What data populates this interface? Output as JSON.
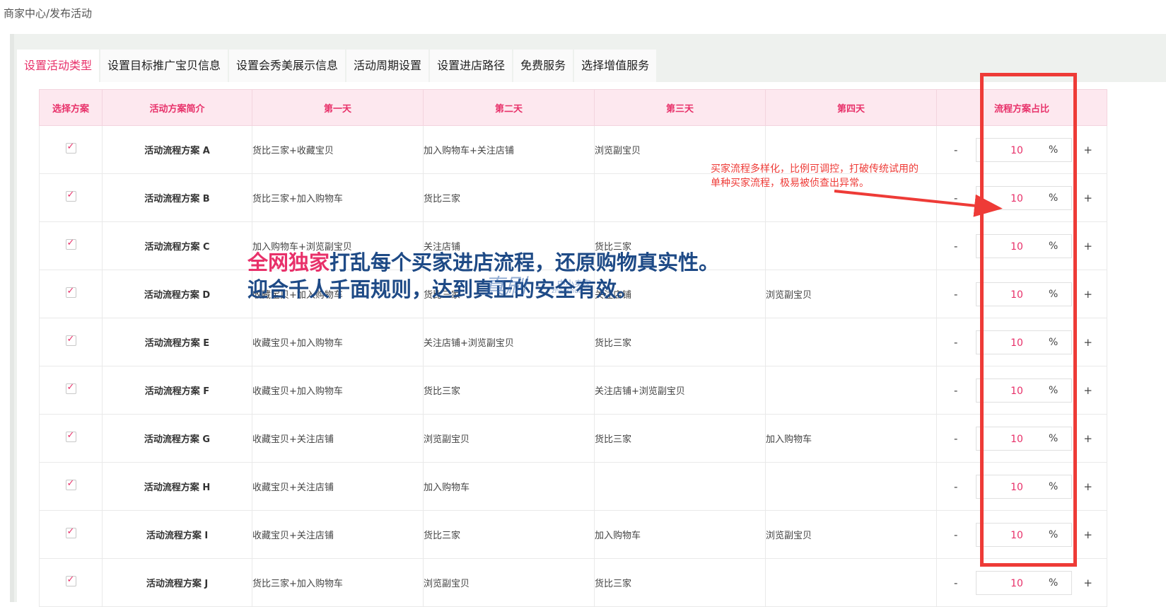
{
  "breadcrumb": "商家中心/发布活动",
  "tabs": [
    {
      "label": "设置活动类型",
      "active": true
    },
    {
      "label": "设置目标推广宝贝信息",
      "active": false
    },
    {
      "label": "设置会秀美展示信息",
      "active": false
    },
    {
      "label": "活动周期设置",
      "active": false
    },
    {
      "label": "设置进店路径",
      "active": false
    },
    {
      "label": "免费服务",
      "active": false
    },
    {
      "label": "选择增值服务",
      "active": false
    }
  ],
  "table": {
    "headers": [
      "选择方案",
      "活动方案简介",
      "第一天",
      "第二天",
      "第三天",
      "第四天",
      "流程方案占比"
    ],
    "rows": [
      {
        "checked": true,
        "name": "活动流程方案 A",
        "day1": "货比三家+收藏宝贝",
        "day2": "加入购物车+关注店铺",
        "day3": "浏览副宝贝",
        "day4": "",
        "ratio": "10",
        "unit": "%"
      },
      {
        "checked": true,
        "name": "活动流程方案 B",
        "day1": "货比三家+加入购物车",
        "day2": "货比三家",
        "day3": "",
        "day4": "",
        "ratio": "10",
        "unit": "%"
      },
      {
        "checked": true,
        "name": "活动流程方案 C",
        "day1": "加入购物车+浏览副宝贝",
        "day2": "关注店铺",
        "day3": "货比三家",
        "day4": "",
        "ratio": "10",
        "unit": "%"
      },
      {
        "checked": true,
        "name": "活动流程方案 D",
        "day1": "收藏宝贝+加入购物车",
        "day2": "货比三家",
        "day3": "关注店铺",
        "day4": "浏览副宝贝",
        "ratio": "10",
        "unit": "%"
      },
      {
        "checked": true,
        "name": "活动流程方案 E",
        "day1": "收藏宝贝+加入购物车",
        "day2": "关注店铺+浏览副宝贝",
        "day3": "货比三家",
        "day4": "",
        "ratio": "10",
        "unit": "%"
      },
      {
        "checked": true,
        "name": "活动流程方案 F",
        "day1": "收藏宝贝+加入购物车",
        "day2": "货比三家",
        "day3": "关注店铺+浏览副宝贝",
        "day4": "",
        "ratio": "10",
        "unit": "%"
      },
      {
        "checked": true,
        "name": "活动流程方案 G",
        "day1": "收藏宝贝+关注店铺",
        "day2": "浏览副宝贝",
        "day3": "货比三家",
        "day4": "加入购物车",
        "ratio": "10",
        "unit": "%"
      },
      {
        "checked": true,
        "name": "活动流程方案 H",
        "day1": "收藏宝贝+关注店铺",
        "day2": "加入购物车",
        "day3": "",
        "day4": "",
        "ratio": "10",
        "unit": "%"
      },
      {
        "checked": true,
        "name": "活动流程方案 I",
        "day1": "收藏宝贝+关注店铺",
        "day2": "货比三家",
        "day3": "加入购物车",
        "day4": "浏览副宝贝",
        "ratio": "10",
        "unit": "%"
      },
      {
        "checked": true,
        "name": "活动流程方案 J",
        "day1": "货比三家+加入购物车",
        "day2": "浏览副宝贝",
        "day3": "货比三家",
        "day4": "",
        "ratio": "10",
        "unit": "%"
      }
    ],
    "minus_label": "-",
    "plus_label": "+"
  },
  "annotation": {
    "note": "买家流程多样化，比例可调控，打破传统试用的单种买家流程，极易被侦查出异常。",
    "color": "#ee3b37"
  },
  "overlay": {
    "line1_highlight": "全网独家",
    "line1_rest": "打乱每个买家进店流程，还原购物真实性。",
    "line2": "迎合千人千面规则，达到真正的安全有效。"
  },
  "watermark": {
    "main": "真刷",
    "sub": "中小卖家",
    "url": "zhenshua"
  },
  "colors": {
    "accent": "#e8316a",
    "header_bg": "#fde8ef",
    "overlay_blue": "#1e4a86",
    "frame_red": "#ee3b37"
  }
}
